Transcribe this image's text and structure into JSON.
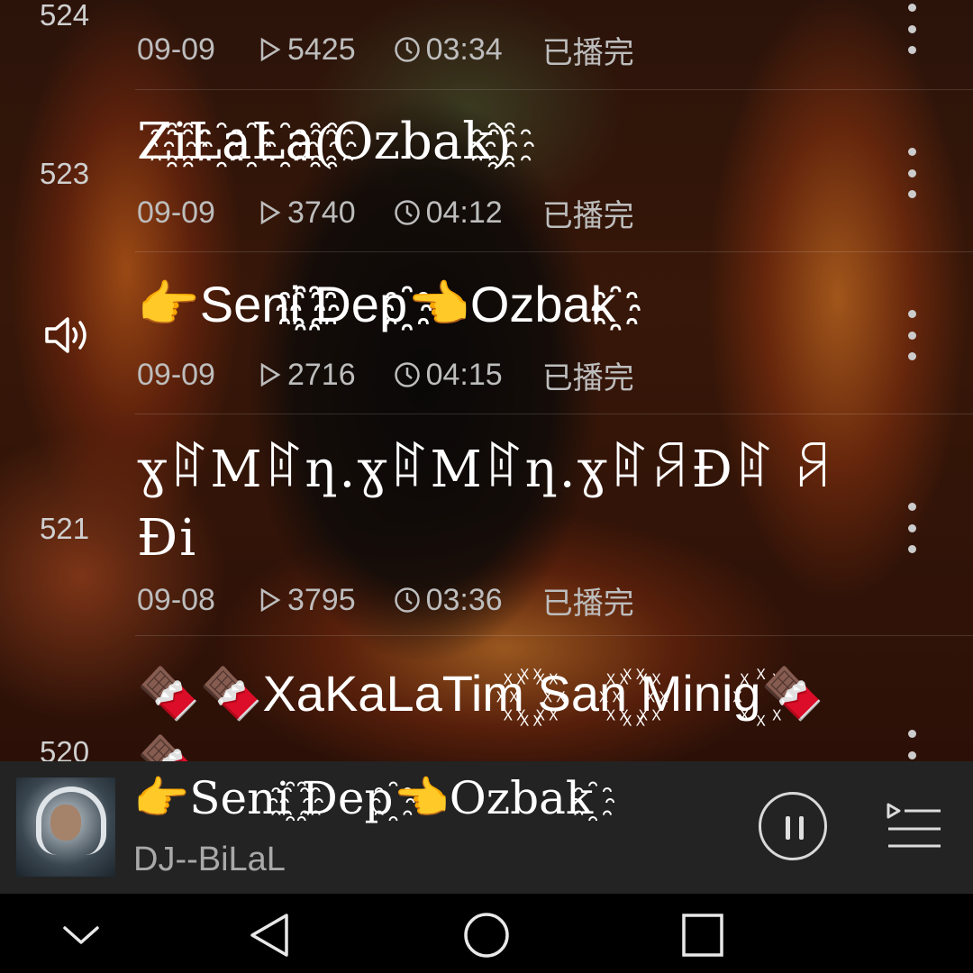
{
  "songs": [
    {
      "num": "524",
      "title": "",
      "date": "09-09",
      "plays": "5425",
      "duration": "03:34",
      "status": "已播完"
    },
    {
      "num": "523",
      "title": "Z҈i҈L҈a҈L҈a҈(҈Ozbak҈)҈",
      "date": "09-09",
      "plays": "3740",
      "duration": "04:12",
      "status": "已播完"
    },
    {
      "num": "",
      "title": "👉Seni҈ ҈Dep҈👈Ozbak҈",
      "date": "09-09",
      "plays": "2716",
      "duration": "04:15",
      "status": "已播完",
      "playing": true
    },
    {
      "num": "521",
      "title": "ɣꍏMꍏƞ.ɣꍏMꍏƞ.ɣꍏꋪĐꍏ ꋪĐi",
      "date": "09-08",
      "plays": "3795",
      "duration": "03:36",
      "status": "已播完"
    },
    {
      "num": "520",
      "title": "🍫🍫XaKaLaTim꙰ ꙰San꙰ ꙰Minig꙰🍫🍫",
      "date": "",
      "plays": "",
      "duration": "",
      "status": ""
    }
  ],
  "player": {
    "title": "👉Seni҈ ҈Dep҈👈Ozbak҈",
    "artist": "DJ--BiLaL"
  },
  "icons": {
    "play": "play-triangle-icon",
    "duration": "clock-icon",
    "speaker": "speaker-icon",
    "more": "more-vertical-icon",
    "pause": "pause-icon",
    "queue": "playlist-queue-icon",
    "nav": [
      "chevron-down-icon",
      "back-icon",
      "home-icon",
      "recents-icon"
    ]
  },
  "colors": {
    "text": "#ffffff",
    "meta": "#bdbdbd",
    "player_bg": "#232323",
    "nav_bg": "#000000"
  }
}
